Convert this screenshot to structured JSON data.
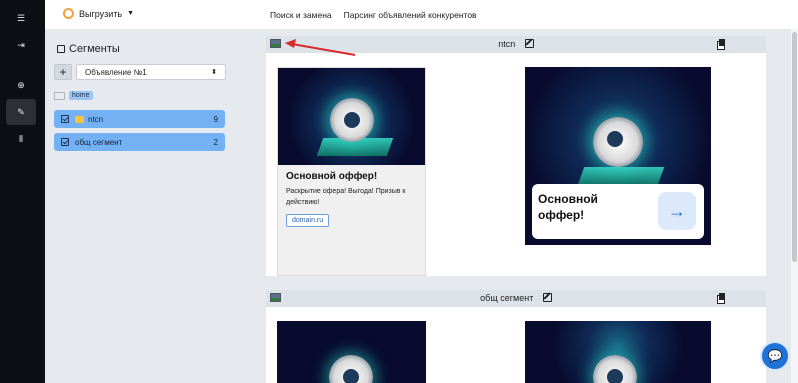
{
  "rail": {
    "items": [
      {
        "icon": "menu-icon",
        "glyph": "☰"
      },
      {
        "icon": "sign-in-icon",
        "glyph": "⇥"
      },
      {
        "icon": "target-icon",
        "glyph": "⊕"
      },
      {
        "icon": "edit-square-icon",
        "glyph": "✎"
      },
      {
        "icon": "library-icon",
        "glyph": "⫴"
      }
    ]
  },
  "topbar": {
    "export_label": "Выгрузить",
    "nav": [
      "Поиск и замена",
      "Парсинг объявлений конкурентов"
    ]
  },
  "segments": {
    "title": "Сегменты",
    "add_label": "+",
    "ad_select_value": "Объявление №1",
    "root_label": "home",
    "items": [
      {
        "label": "ntcn",
        "count": "9",
        "has_folder": true
      },
      {
        "label": "общ сегмент",
        "count": "2",
        "has_folder": false
      }
    ]
  },
  "cards": [
    {
      "name": "ntcn",
      "ad": {
        "title": "Основной оффер!",
        "text": "Раскрытие офера! Выгода! Призыв к действию!",
        "link": "domain.ru",
        "overlay_title": "Основной оффер!"
      }
    },
    {
      "name": "общ сегмент"
    }
  ],
  "colors": {
    "rail": "#0d0f14",
    "panel": "#e6e9ee",
    "segment_selected": "#74b1f4",
    "accent": "#1e72d8"
  }
}
